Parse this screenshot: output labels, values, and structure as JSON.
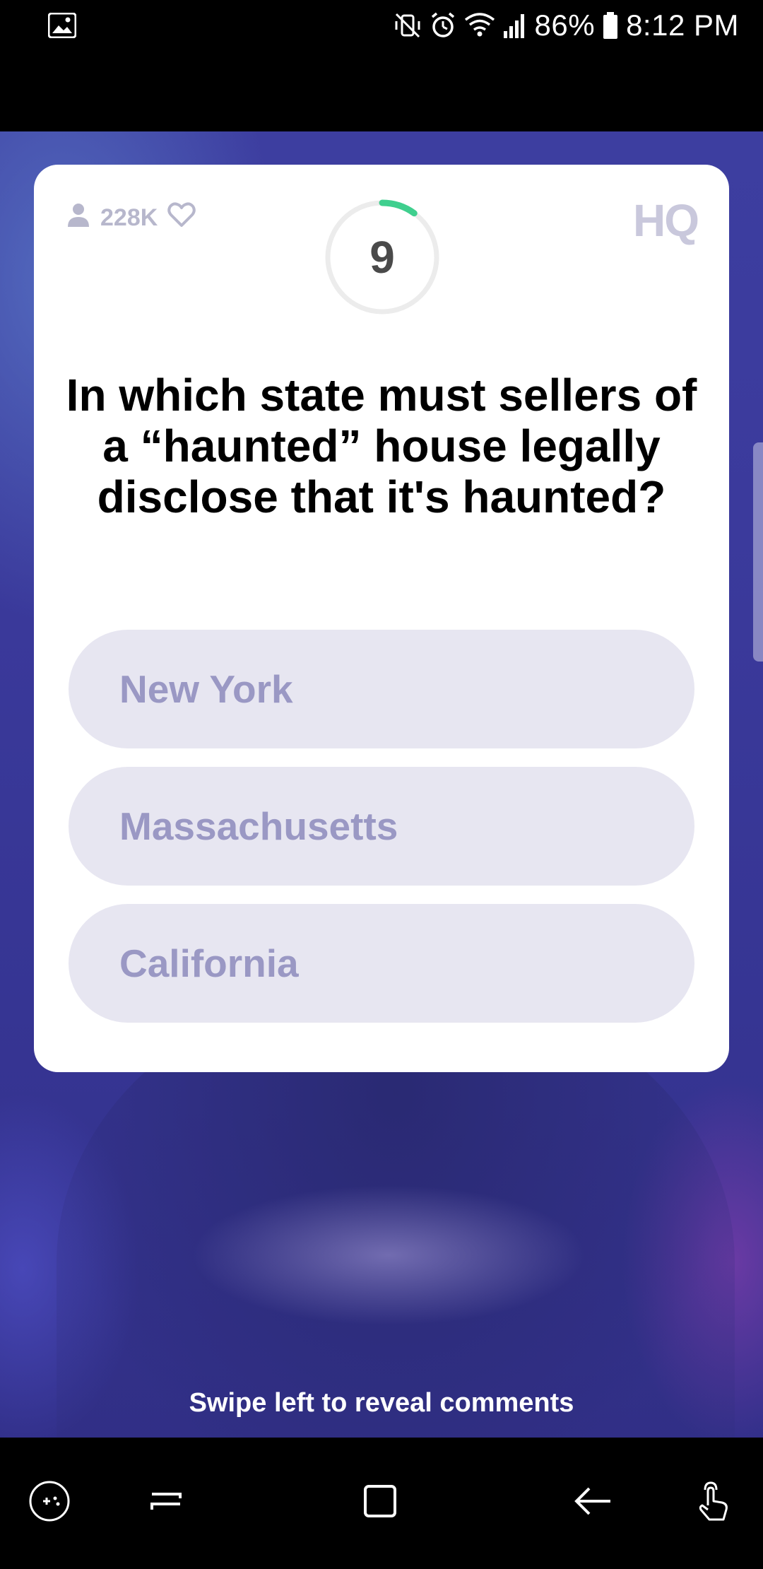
{
  "status_bar": {
    "battery": "86%",
    "time": "8:12 PM",
    "left_icon": "image-icon",
    "right_icons": [
      "vibrate-mute-icon",
      "alarm-icon",
      "wifi-icon",
      "signal-icon",
      "battery-icon"
    ]
  },
  "game": {
    "viewer_count": "228K",
    "timer_value": "9",
    "timer_progress": 0.1,
    "logo": "HQ",
    "question": "In which state must sellers of a “haunted” house legally disclose that it's haunted?",
    "answers": [
      "New York",
      "Massachusetts",
      "California"
    ],
    "swipe_hint": "Swipe left to reveal comments"
  },
  "colors": {
    "card_bg": "#ffffff",
    "answer_bg": "#e7e6f1",
    "answer_text": "#9a98c4",
    "timer_progress": "#3fcf8e",
    "stage_bg": "#3b3a9c"
  },
  "nav_bar": {
    "buttons": [
      "game-tools-icon",
      "recent-apps-icon",
      "home-icon",
      "back-icon",
      "touch-gesture-icon"
    ]
  }
}
